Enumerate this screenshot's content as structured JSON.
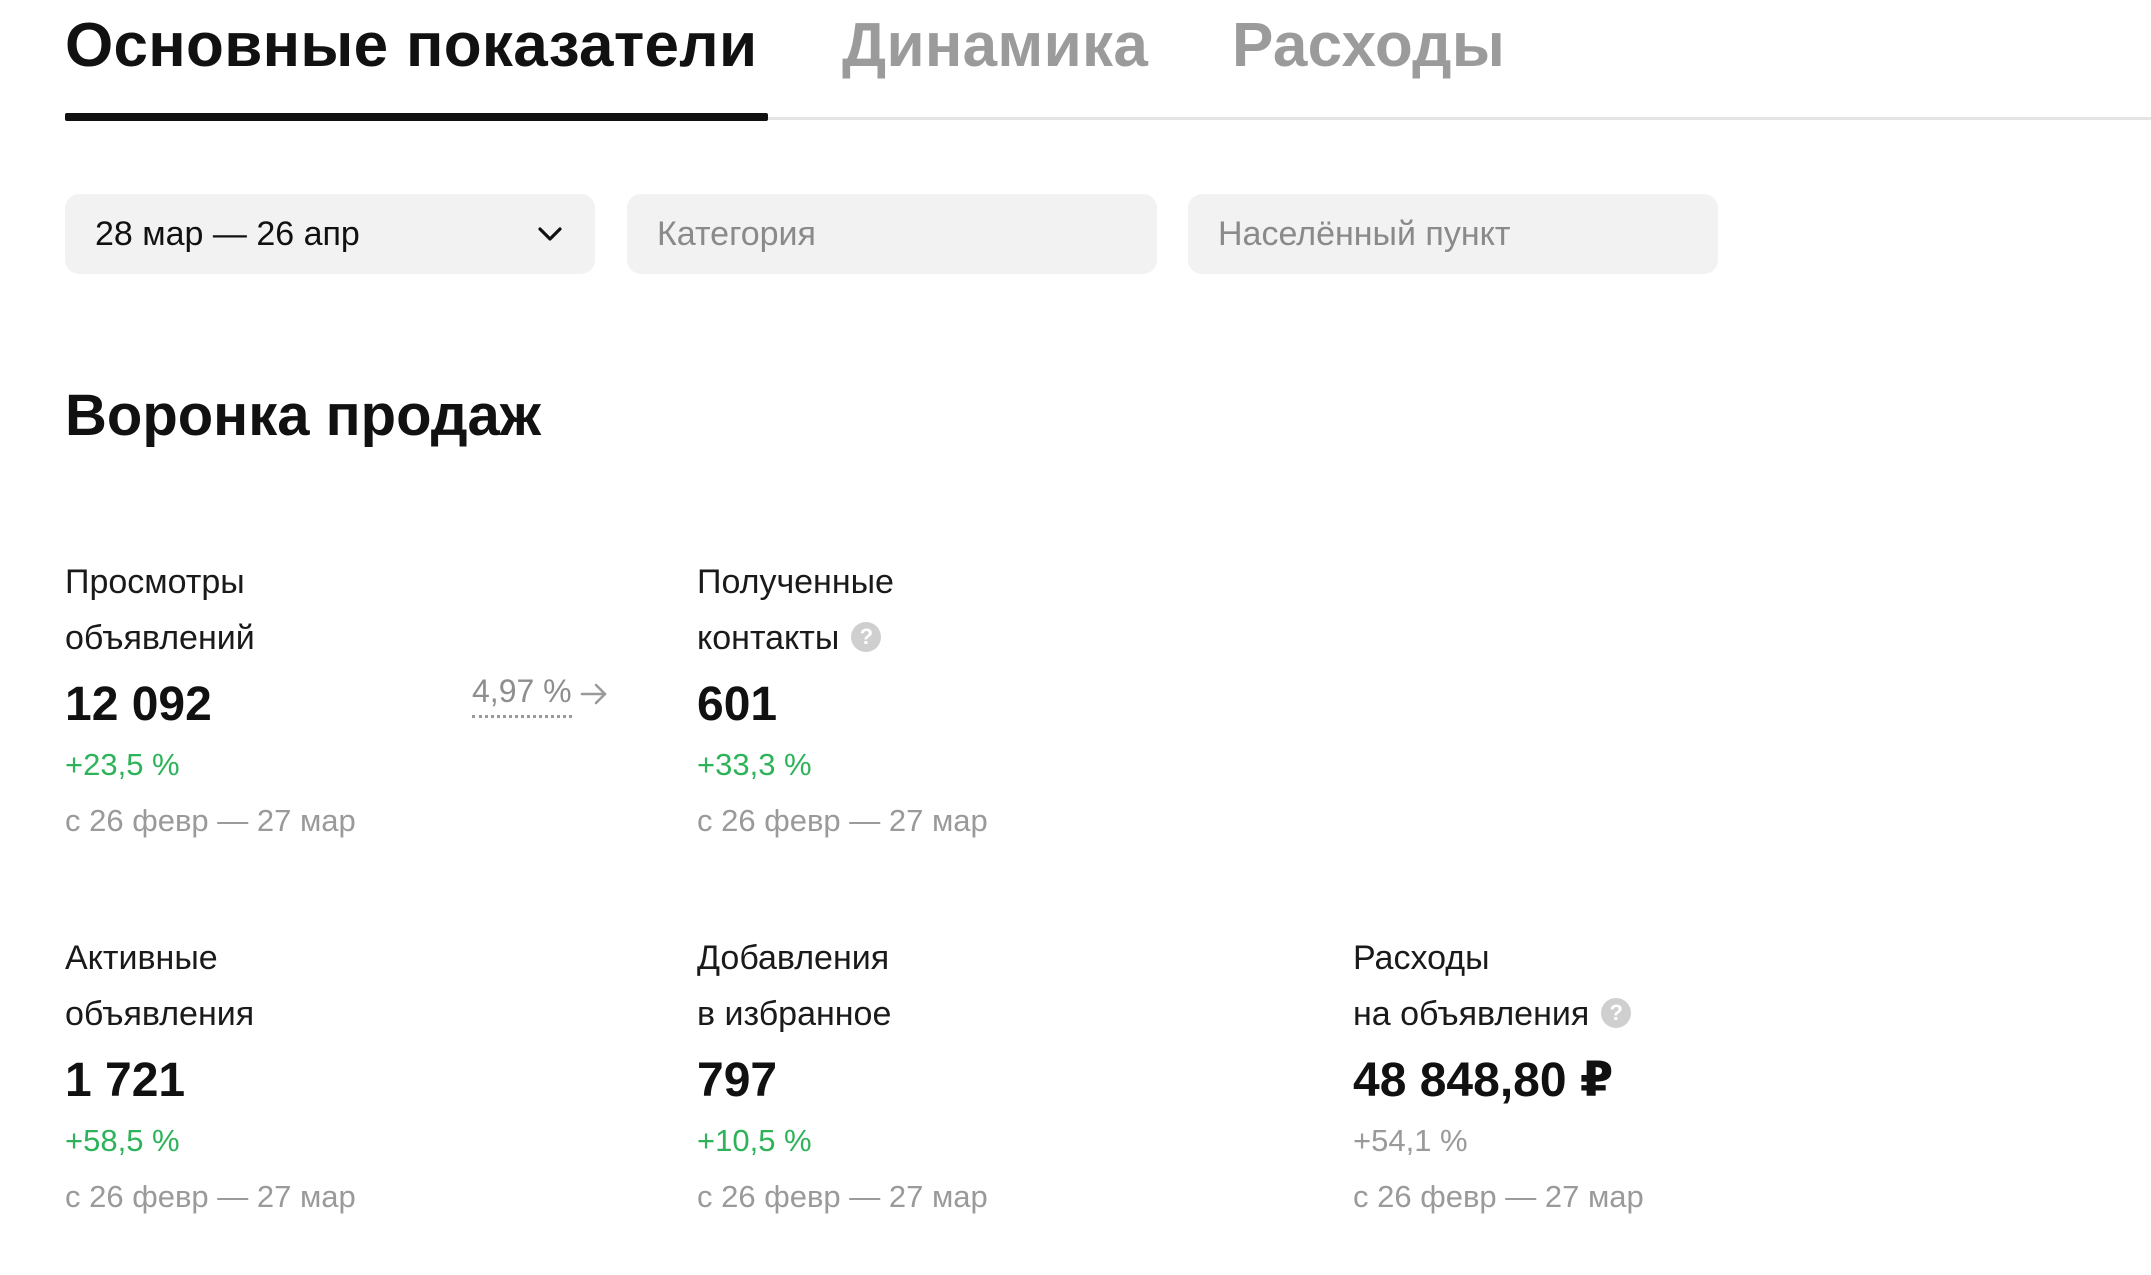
{
  "tabs": [
    {
      "label": "Основные показатели",
      "active": true
    },
    {
      "label": "Динамика",
      "active": false
    },
    {
      "label": "Расходы",
      "active": false
    }
  ],
  "filters": {
    "date_range": {
      "value": "28 мар — 26 апр",
      "icon": "chevron-down-icon"
    },
    "category": {
      "placeholder": "Категория"
    },
    "locality": {
      "placeholder": "Населённый пункт"
    }
  },
  "funnel": {
    "title": "Воронка продаж",
    "conversion": {
      "value": "4,97 %",
      "icon": "arrow-right-icon"
    },
    "metrics": {
      "views": {
        "label_line1": "Просмотры",
        "label_line2": "объявлений",
        "value": "12 092",
        "change": "+23,5 %",
        "period": "с 26 февр — 27 мар"
      },
      "contacts": {
        "label_line1": "Полученные",
        "label_line2": "контакты",
        "value": "601",
        "change": "+33,3 %",
        "period": "с 26 февр — 27 мар",
        "help_icon": "question-icon"
      },
      "active_ads": {
        "label_line1": "Активные",
        "label_line2": "объявления",
        "value": "1 721",
        "change": "+58,5 %",
        "period": "с 26 февр — 27 мар"
      },
      "favorites": {
        "label_line1": "Добавления",
        "label_line2": "в избранное",
        "value": "797",
        "change": "+10,5 %",
        "period": "с 26 февр — 27 мар"
      },
      "ad_spend": {
        "label_line1": "Расходы",
        "label_line2": "на объявления",
        "value": "48 848,80 ₽",
        "change": "+54,1 %",
        "period": "с 26 февр — 27 мар",
        "help_icon": "question-icon"
      }
    }
  },
  "colors": {
    "text_primary": "#111111",
    "tab_inactive": "#9b9b9b",
    "positive_change": "#2fb35a",
    "muted": "#9a9a9a",
    "filter_bg": "#f2f2f2",
    "help_icon_bg": "#cfcfcf"
  }
}
